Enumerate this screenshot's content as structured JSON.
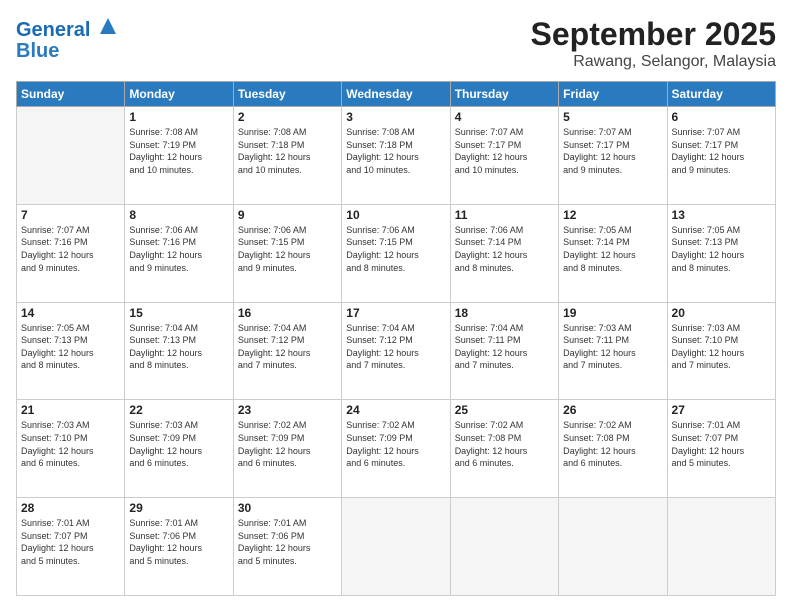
{
  "logo": {
    "line1": "General",
    "line2": "Blue"
  },
  "header": {
    "month": "September 2025",
    "location": "Rawang, Selangor, Malaysia"
  },
  "weekdays": [
    "Sunday",
    "Monday",
    "Tuesday",
    "Wednesday",
    "Thursday",
    "Friday",
    "Saturday"
  ],
  "weeks": [
    [
      {
        "day": "",
        "info": ""
      },
      {
        "day": "1",
        "info": "Sunrise: 7:08 AM\nSunset: 7:19 PM\nDaylight: 12 hours\nand 10 minutes."
      },
      {
        "day": "2",
        "info": "Sunrise: 7:08 AM\nSunset: 7:18 PM\nDaylight: 12 hours\nand 10 minutes."
      },
      {
        "day": "3",
        "info": "Sunrise: 7:08 AM\nSunset: 7:18 PM\nDaylight: 12 hours\nand 10 minutes."
      },
      {
        "day": "4",
        "info": "Sunrise: 7:07 AM\nSunset: 7:17 PM\nDaylight: 12 hours\nand 10 minutes."
      },
      {
        "day": "5",
        "info": "Sunrise: 7:07 AM\nSunset: 7:17 PM\nDaylight: 12 hours\nand 9 minutes."
      },
      {
        "day": "6",
        "info": "Sunrise: 7:07 AM\nSunset: 7:17 PM\nDaylight: 12 hours\nand 9 minutes."
      }
    ],
    [
      {
        "day": "7",
        "info": "Sunrise: 7:07 AM\nSunset: 7:16 PM\nDaylight: 12 hours\nand 9 minutes."
      },
      {
        "day": "8",
        "info": "Sunrise: 7:06 AM\nSunset: 7:16 PM\nDaylight: 12 hours\nand 9 minutes."
      },
      {
        "day": "9",
        "info": "Sunrise: 7:06 AM\nSunset: 7:15 PM\nDaylight: 12 hours\nand 9 minutes."
      },
      {
        "day": "10",
        "info": "Sunrise: 7:06 AM\nSunset: 7:15 PM\nDaylight: 12 hours\nand 8 minutes."
      },
      {
        "day": "11",
        "info": "Sunrise: 7:06 AM\nSunset: 7:14 PM\nDaylight: 12 hours\nand 8 minutes."
      },
      {
        "day": "12",
        "info": "Sunrise: 7:05 AM\nSunset: 7:14 PM\nDaylight: 12 hours\nand 8 minutes."
      },
      {
        "day": "13",
        "info": "Sunrise: 7:05 AM\nSunset: 7:13 PM\nDaylight: 12 hours\nand 8 minutes."
      }
    ],
    [
      {
        "day": "14",
        "info": "Sunrise: 7:05 AM\nSunset: 7:13 PM\nDaylight: 12 hours\nand 8 minutes."
      },
      {
        "day": "15",
        "info": "Sunrise: 7:04 AM\nSunset: 7:13 PM\nDaylight: 12 hours\nand 8 minutes."
      },
      {
        "day": "16",
        "info": "Sunrise: 7:04 AM\nSunset: 7:12 PM\nDaylight: 12 hours\nand 7 minutes."
      },
      {
        "day": "17",
        "info": "Sunrise: 7:04 AM\nSunset: 7:12 PM\nDaylight: 12 hours\nand 7 minutes."
      },
      {
        "day": "18",
        "info": "Sunrise: 7:04 AM\nSunset: 7:11 PM\nDaylight: 12 hours\nand 7 minutes."
      },
      {
        "day": "19",
        "info": "Sunrise: 7:03 AM\nSunset: 7:11 PM\nDaylight: 12 hours\nand 7 minutes."
      },
      {
        "day": "20",
        "info": "Sunrise: 7:03 AM\nSunset: 7:10 PM\nDaylight: 12 hours\nand 7 minutes."
      }
    ],
    [
      {
        "day": "21",
        "info": "Sunrise: 7:03 AM\nSunset: 7:10 PM\nDaylight: 12 hours\nand 6 minutes."
      },
      {
        "day": "22",
        "info": "Sunrise: 7:03 AM\nSunset: 7:09 PM\nDaylight: 12 hours\nand 6 minutes."
      },
      {
        "day": "23",
        "info": "Sunrise: 7:02 AM\nSunset: 7:09 PM\nDaylight: 12 hours\nand 6 minutes."
      },
      {
        "day": "24",
        "info": "Sunrise: 7:02 AM\nSunset: 7:09 PM\nDaylight: 12 hours\nand 6 minutes."
      },
      {
        "day": "25",
        "info": "Sunrise: 7:02 AM\nSunset: 7:08 PM\nDaylight: 12 hours\nand 6 minutes."
      },
      {
        "day": "26",
        "info": "Sunrise: 7:02 AM\nSunset: 7:08 PM\nDaylight: 12 hours\nand 6 minutes."
      },
      {
        "day": "27",
        "info": "Sunrise: 7:01 AM\nSunset: 7:07 PM\nDaylight: 12 hours\nand 5 minutes."
      }
    ],
    [
      {
        "day": "28",
        "info": "Sunrise: 7:01 AM\nSunset: 7:07 PM\nDaylight: 12 hours\nand 5 minutes."
      },
      {
        "day": "29",
        "info": "Sunrise: 7:01 AM\nSunset: 7:06 PM\nDaylight: 12 hours\nand 5 minutes."
      },
      {
        "day": "30",
        "info": "Sunrise: 7:01 AM\nSunset: 7:06 PM\nDaylight: 12 hours\nand 5 minutes."
      },
      {
        "day": "",
        "info": ""
      },
      {
        "day": "",
        "info": ""
      },
      {
        "day": "",
        "info": ""
      },
      {
        "day": "",
        "info": ""
      }
    ]
  ]
}
